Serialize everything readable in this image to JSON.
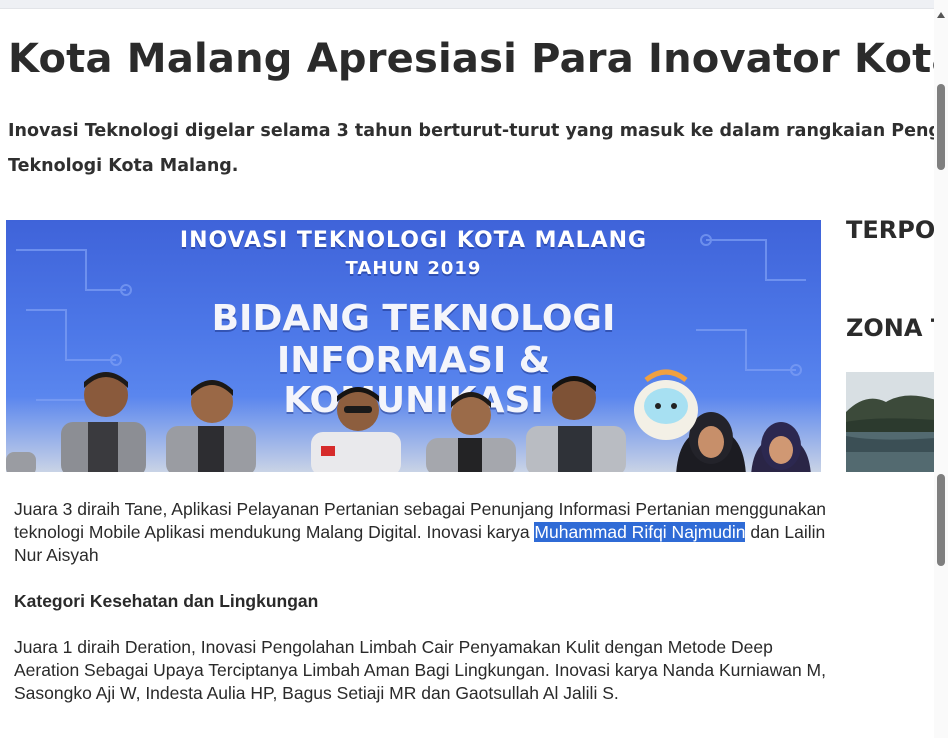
{
  "article": {
    "title": "Kota Malang Apresiasi Para Inovator Kota Malang",
    "lede_line1": "Inovasi Teknologi digelar selama 3 tahun berturut-turut yang masuk ke dalam rangkaian Penganugerahan Inovasi",
    "lede_line2": "Teknologi Kota Malang.",
    "hero_banner": {
      "line1": "INOVASI TEKNOLOGI KOTA MALANG",
      "line2": "TAHUN 2019",
      "line3": "BIDANG TEKNOLOGI",
      "line4": "INFORMASI &",
      "line5": "KOMUNIKASI"
    },
    "para1_before": "Juara 3 diraih Tane, Aplikasi Pelayanan Pertanian sebagai Penunjang Informasi Pertanian menggunakan teknologi Mobile Aplikasi mendukung Malang Digital. Inovasi karya ",
    "para1_highlight": "Muhammad Rifqi Najmudin",
    "para1_after": " dan Lailin Nur Aisyah",
    "subheading": "Kategori Kesehatan dan Lingkungan",
    "para2": "Juara 1 diraih Deration, Inovasi Pengolahan Limbah Cair Penyamakan Kulit dengan Metode Deep Aeration Sebagai Upaya Terciptanya Limbah Aman Bagi Lingkungan. Inovasi karya Nanda Kurniawan M, Sasongko Aji W, Indesta Aulia HP, Bagus Setiaji MR dan Gaotsullah Al Jalili S."
  },
  "sidebar": {
    "heading1": "TERPOPULER",
    "heading2": "ZONA TOP"
  },
  "colors": {
    "selection_highlight": "#2f6bd6",
    "banner_blue": "#4d78e8"
  }
}
